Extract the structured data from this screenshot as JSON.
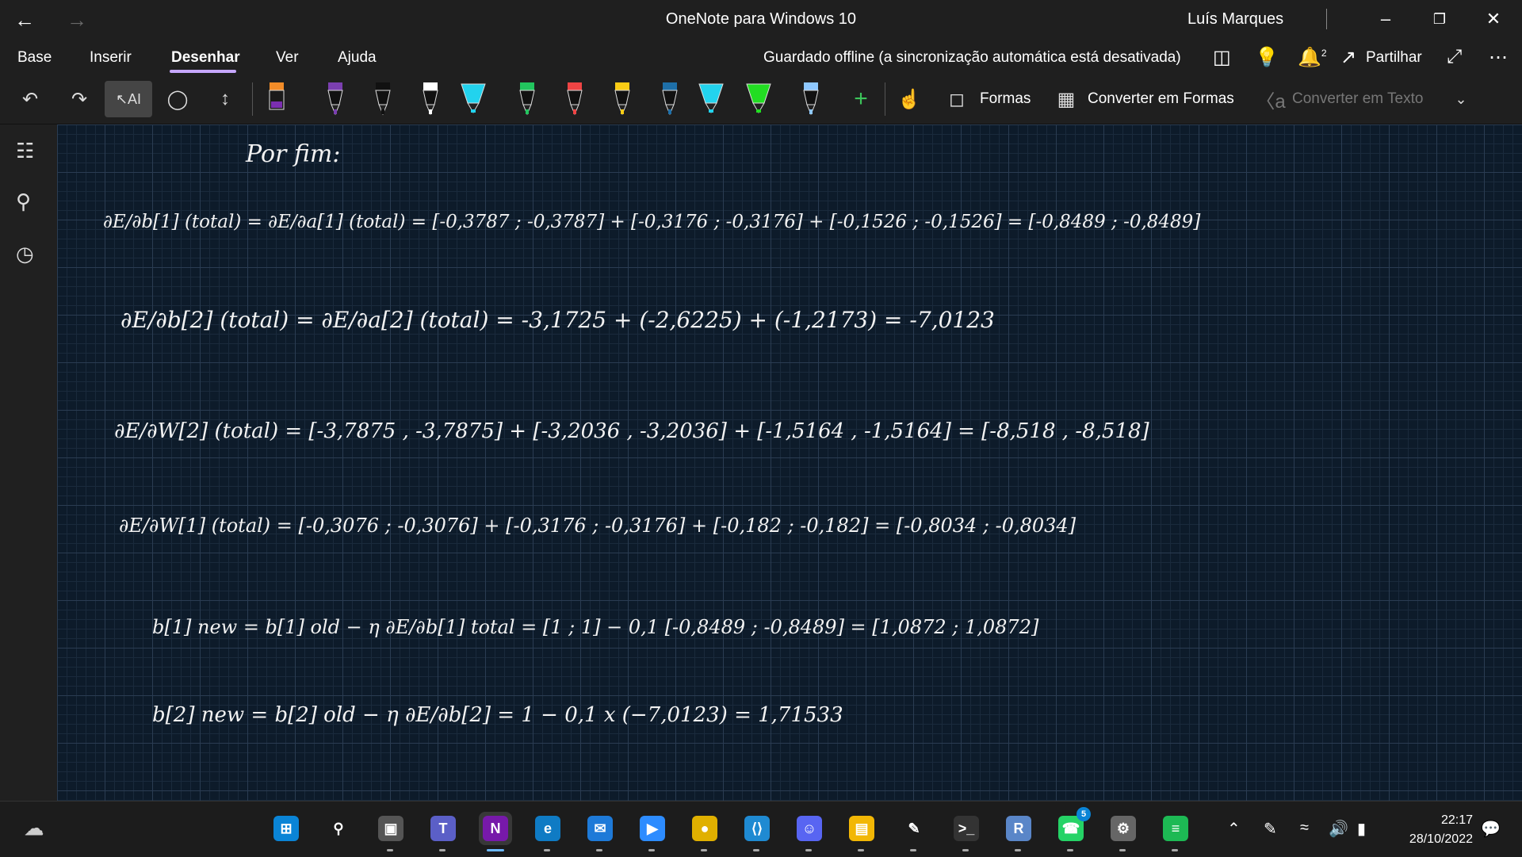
{
  "window": {
    "title": "OneNote para Windows 10",
    "user": "Luís Marques",
    "minimize_icon": "minimize-icon",
    "restore_icon": "restore-icon",
    "close_icon": "close-icon"
  },
  "menu": {
    "tabs": [
      "Base",
      "Inserir",
      "Desenhar",
      "Ver",
      "Ajuda"
    ],
    "active_tab": "Desenhar",
    "status": "Guardado offline (a sincronização automática está desativada)",
    "notifications_count": "2",
    "share_label": "Partilhar"
  },
  "toolbar": {
    "shapes_label": "Formas",
    "convert_shapes_label": "Converter em Formas",
    "convert_text_label": "Converter em Texto",
    "pens": [
      {
        "color": "#f28c28",
        "type": "highlighter-box"
      },
      {
        "color": "#7b3fb0",
        "type": "pen"
      },
      {
        "color": "#111111",
        "type": "pen"
      },
      {
        "color": "#ffffff",
        "type": "pen"
      },
      {
        "color": "#22d3ee",
        "type": "highlighter"
      },
      {
        "color": "#22c55e",
        "type": "pen"
      },
      {
        "color": "#ef4444",
        "type": "pen"
      },
      {
        "color": "#facc15",
        "type": "pen"
      },
      {
        "color": "#1e6fa8",
        "type": "pen"
      },
      {
        "color": "#22d3ee",
        "type": "highlighter"
      },
      {
        "color": "#22dd22",
        "type": "highlighter"
      },
      {
        "color": "#8ec8ff",
        "type": "pen"
      }
    ]
  },
  "notes": {
    "heading": "Por fim:",
    "lines": [
      "∂E/∂b[1] (total) = ∂E/∂a[1] (total) = [-0,3787 ; -0,3787] + [-0,3176 ; -0,3176] + [-0,1526 ; -0,1526] = [-0,8489 ; -0,8489]",
      "∂E/∂b[2] (total) = ∂E/∂a[2] (total) = -3,1725 + (-2,6225) + (-1,2173) = -7,0123",
      "∂E/∂W[2] (total) = [-3,7875 , -3,7875] + [-3,2036 , -3,2036] + [-1,5164 , -1,5164] = [-8,518 , -8,518]",
      "∂E/∂W[1] (total) = [-0,3076 ; -0,3076] + [-0,3176 ; -0,3176] + [-0,182 ; -0,182] = [-0,8034 ; -0,8034]",
      "b[1] new = b[1] old − η ∂E/∂b[1] total = [1 ; 1] − 0,1 [-0,8489 ; -0,8489] = [1,0872 ; 1,0872]",
      "b[2] new = b[2] old − η ∂E/∂b[2] = 1 − 0,1 x (−7,0123) = 1,71533"
    ]
  },
  "taskbar": {
    "apps": [
      "Start",
      "Search",
      "Task View",
      "Teams",
      "OneNote",
      "Edge",
      "Mail",
      "Zoom",
      "Chrome",
      "VS Code",
      "Discord",
      "File Explorer",
      "Pen app",
      "Terminal",
      "R",
      "WhatsApp",
      "Settings",
      "Spotify"
    ],
    "whatsapp_badge": "5",
    "time": "22:17",
    "date": "28/10/2022"
  }
}
